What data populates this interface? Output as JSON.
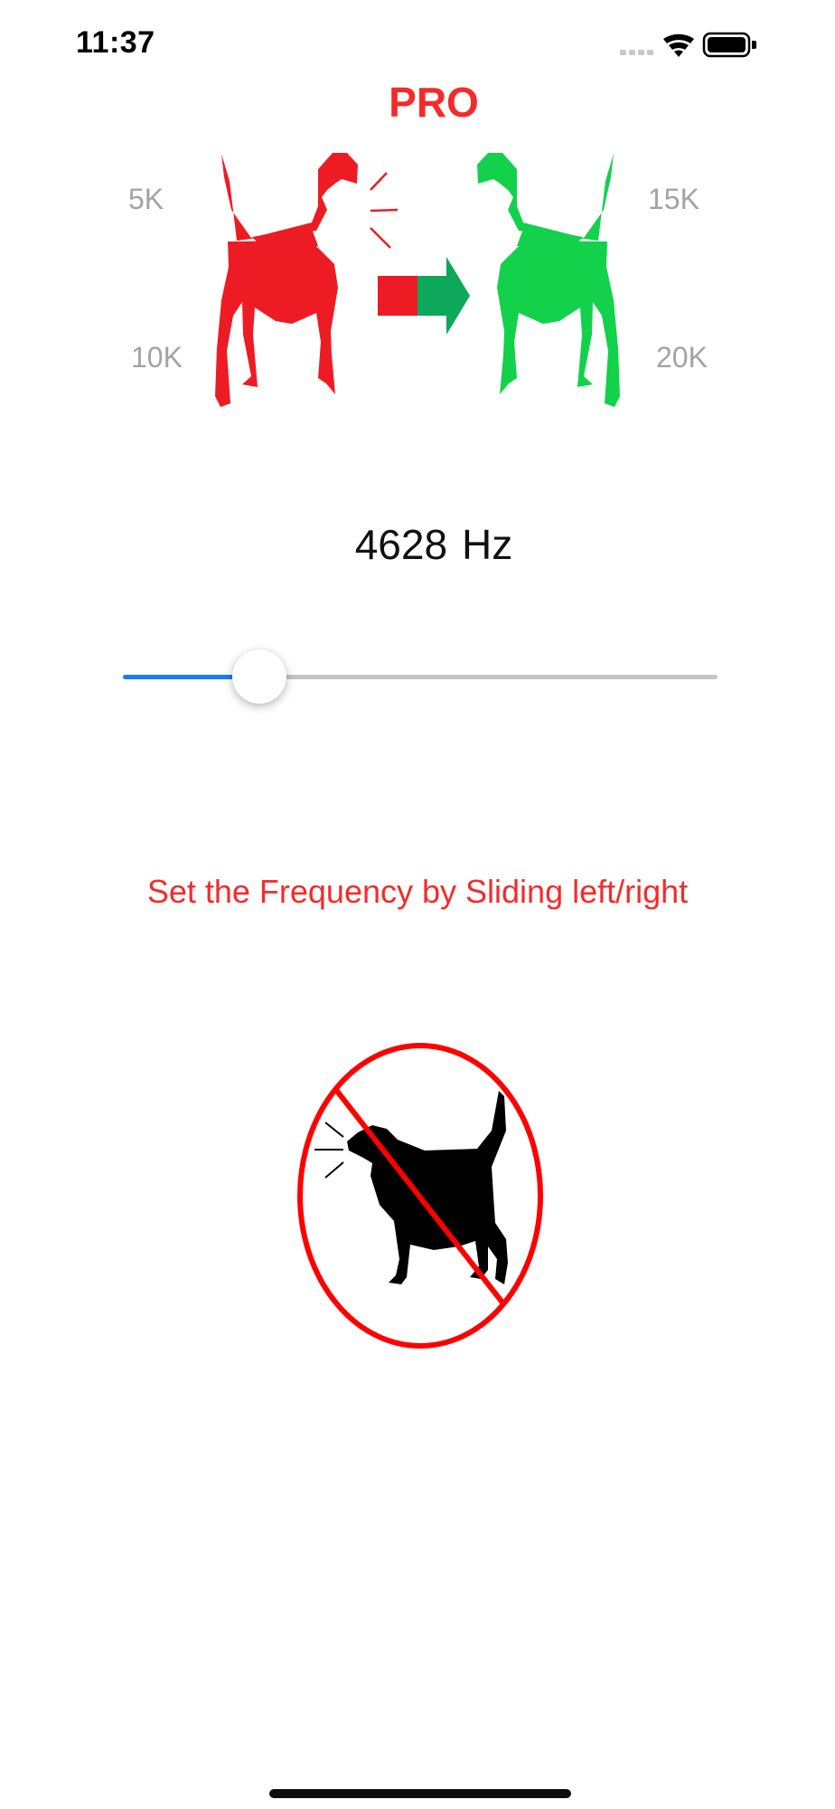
{
  "status_bar": {
    "time": "11:37"
  },
  "header": {
    "title": "PRO",
    "title_color": "#f42b2b"
  },
  "hero": {
    "labels": {
      "top_left": "5K",
      "bottom_left": "10K",
      "top_right": "15K",
      "bottom_right": "20K"
    },
    "icons": [
      "barking-dog-icon",
      "arrow-right-icon",
      "quiet-dog-icon"
    ],
    "colors": {
      "barking_dog": "#ed1c24",
      "quiet_dog": "#13d14b",
      "arrow_left": "#ed1c24",
      "arrow_right": "#0ea85a",
      "label": "#a3a3a3"
    }
  },
  "frequency": {
    "value": "4628",
    "unit": "Hz"
  },
  "slider": {
    "level": 0.23,
    "fill_color": "#1d7cf2",
    "track_color": "#c4c4c4"
  },
  "instruction": "Set the Frequency by Sliding left/right",
  "no_bark": {
    "icon": "no-barking-icon",
    "ring_color": "#ff0000"
  }
}
